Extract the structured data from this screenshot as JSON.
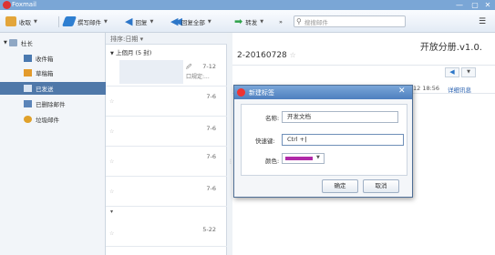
{
  "window": {
    "title": "Foxmail",
    "minimize": "—",
    "close": "✕"
  },
  "toolbar": {
    "receive": "收取",
    "compose": "撰写邮件",
    "reply": "回复",
    "reply_all": "回复全部",
    "forward": "转发",
    "more": "»",
    "search_placeholder": "搜搜邮件",
    "menu": "☰"
  },
  "sidebar": {
    "account": "杜长",
    "items": [
      {
        "label": "收件箱",
        "icon": "inbox-icon"
      },
      {
        "label": "草稿箱",
        "icon": "drafts-icon"
      },
      {
        "label": "已发送",
        "icon": "sent-icon"
      },
      {
        "label": "已删除邮件",
        "icon": "trash-icon"
      },
      {
        "label": "垃圾邮件",
        "icon": "junk-icon"
      }
    ],
    "selected_index": 2
  },
  "list": {
    "sort_label": "排序:日期 ▾",
    "group_label": "上個月 (5 封)",
    "rows": [
      {
        "date": "7-12",
        "snippet": "口规定:..."
      },
      {
        "date": "7-6",
        "snippet": ""
      },
      {
        "date": "7-6",
        "snippet": ""
      },
      {
        "date": "7-6",
        "snippet": ""
      },
      {
        "date": "7-6",
        "snippet": ""
      }
    ],
    "group2_toggle": "▾",
    "rows2": [
      {
        "date": "5-22"
      }
    ]
  },
  "reader": {
    "title_right": "开放分册.v1.0.",
    "subject": "2-20160728",
    "time": "12 18:56",
    "details_link": "详细讯息"
  },
  "dialog": {
    "title": "新建标签",
    "name_label": "名称:",
    "name_value": "开发文档",
    "shortcut_label": "快速键:",
    "shortcut_value": "Ctrl +",
    "color_label": "颜色:",
    "color_value": "#b02aa8",
    "ok": "确定",
    "cancel": "取消"
  }
}
